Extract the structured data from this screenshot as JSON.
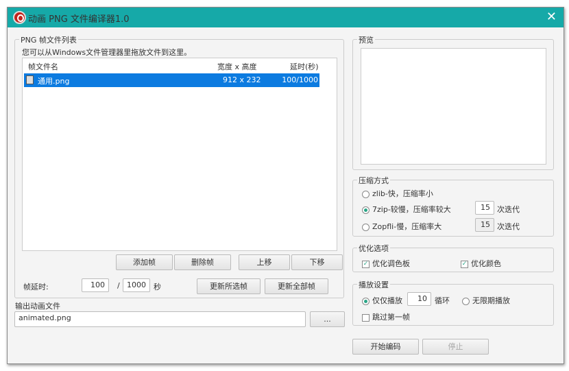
{
  "title": "动画 PNG 文件编译器1.0",
  "frames": {
    "legend": "PNG 帧文件列表",
    "hint": "您可以从Windows文件管理器里拖放文件到这里。",
    "columns": [
      "帧文件名",
      "宽度 x 高度",
      "延时(秒)"
    ],
    "rows": [
      {
        "name": "通用.png",
        "size": "912 x 232",
        "delay": "100/1000"
      }
    ],
    "add": "添加帧",
    "delete": "删除帧",
    "up": "上移",
    "down": "下移",
    "delay_label": "帧延时:",
    "delay_num": "100",
    "delay_sep": "/",
    "delay_den": "1000",
    "sec": "秒",
    "update_selected": "更新所选帧",
    "update_all": "更新全部帧"
  },
  "output": {
    "label": "输出动画文件",
    "value": "animated.png",
    "browse": "..."
  },
  "preview": {
    "legend": "预览"
  },
  "compress": {
    "legend": "压缩方式",
    "opt1": "zlib-快，压缩率小",
    "opt2": "7zip-较慢，压缩率较大",
    "opt3": "Zopfli-慢，压缩率大",
    "iter2": "15",
    "iter3": "15",
    "iter_label": "次迭代",
    "selected": 2
  },
  "optimize": {
    "legend": "优化选项",
    "palette": "优化调色板",
    "color": "优化颜色"
  },
  "play": {
    "legend": "播放设置",
    "only": "仅仅播放",
    "loops": "10",
    "loop_label": "循环",
    "infinite": "无限期播放",
    "skip": "跳过第一帧"
  },
  "start": "开始编码",
  "stop": "停止"
}
